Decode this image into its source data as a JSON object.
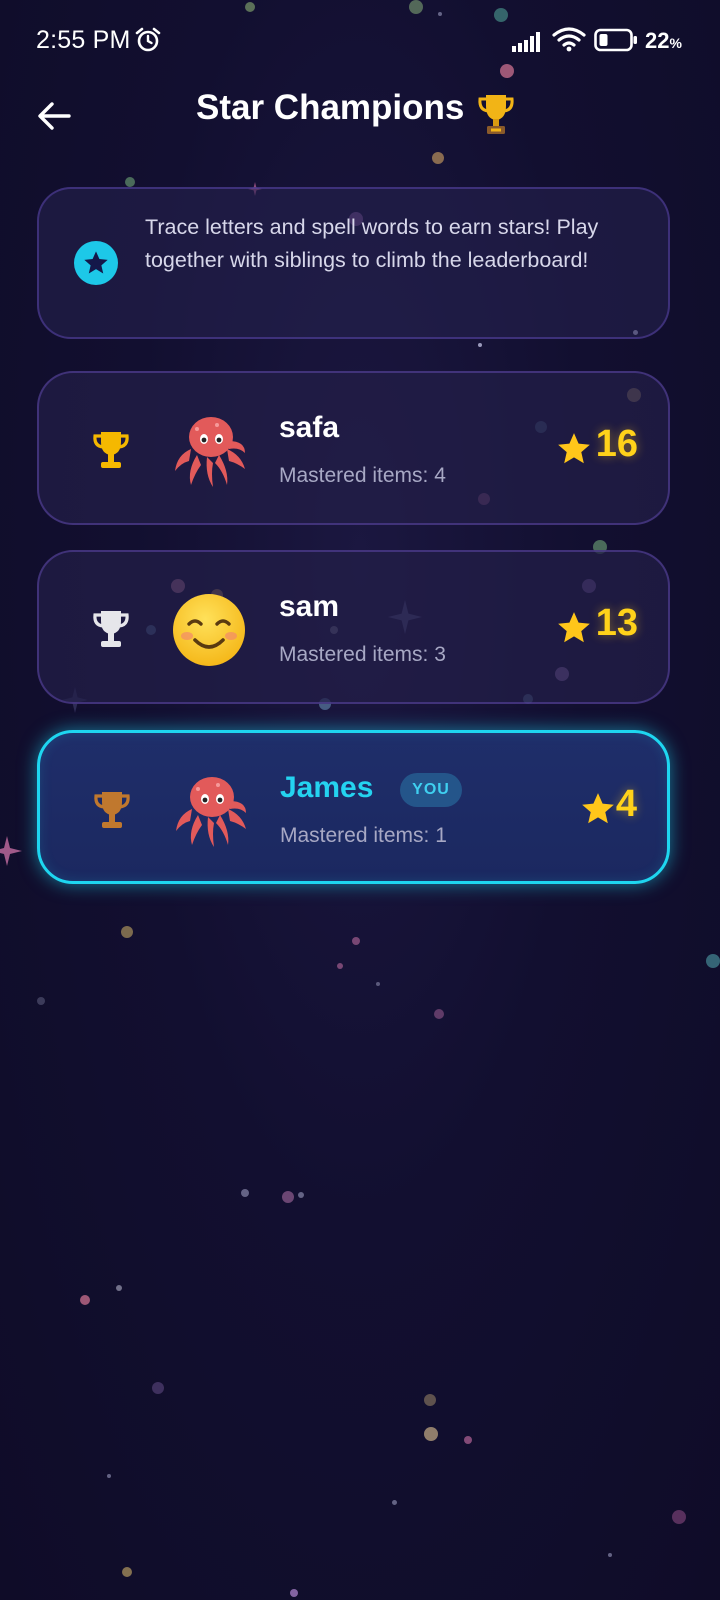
{
  "status_bar": {
    "time": "2:55 PM",
    "battery_value": "22",
    "battery_unit": "%",
    "icons": [
      "alarm-icon",
      "signal-icon",
      "wifi-icon",
      "battery-icon"
    ]
  },
  "header": {
    "title": "Star Champions",
    "title_icon": "trophy-icon",
    "back_icon": "arrow-left-icon"
  },
  "info_card": {
    "icon": "star-badge-icon",
    "text": "Trace letters and spell words to earn stars! Play together with siblings to climb the leaderboard!"
  },
  "leaderboard": [
    {
      "rank_icon": "gold-trophy-icon",
      "avatar": "octopus",
      "name": "safa",
      "mastered": "Mastered items: 4",
      "stars": "16",
      "is_you": false
    },
    {
      "rank_icon": "silver-trophy-icon",
      "avatar": "smiling-face",
      "name": "sam",
      "mastered": "Mastered items: 3",
      "stars": "13",
      "is_you": false
    },
    {
      "rank_icon": "bronze-trophy-icon",
      "avatar": "octopus",
      "name": "James",
      "badge": "YOU",
      "mastered": "Mastered items: 1",
      "stars": "4",
      "is_you": true
    }
  ],
  "colors": {
    "background": "#120f30",
    "accent_cyan": "#1ed6f0",
    "star_gold": "#ffd21a",
    "gold": "#f5b800",
    "silver": "#e6e6ea",
    "bronze": "#c0782e"
  }
}
